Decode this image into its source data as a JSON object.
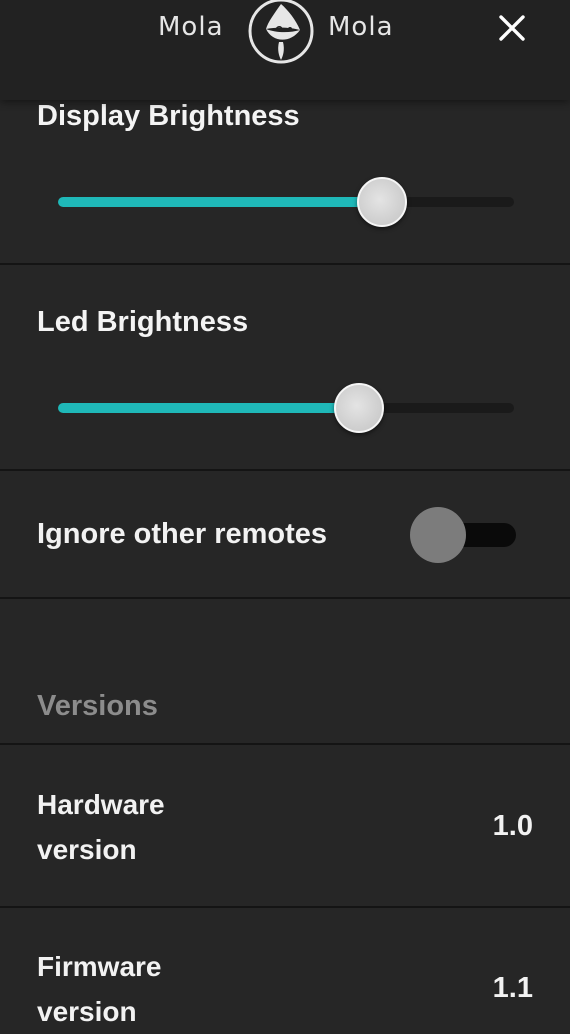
{
  "header": {
    "logo_left": "Mola",
    "logo_right": "Mola",
    "close_icon": "close-icon"
  },
  "settings": {
    "display_brightness": {
      "label": "Display Brightness",
      "value_percent": 71
    },
    "led_brightness": {
      "label": "Led Brightness",
      "value_percent": 66
    },
    "ignore_remotes": {
      "label": "Ignore other remotes",
      "enabled": false
    }
  },
  "versions": {
    "heading": "Versions",
    "hardware": {
      "label_line1": "Hardware",
      "label_line2": "version",
      "value": "1.0"
    },
    "firmware": {
      "label_line1": "Firmware",
      "label_line2": "version",
      "value": "1.1"
    }
  },
  "colors": {
    "accent": "#1fb8b8",
    "background": "#262626",
    "header": "#222222",
    "muted_text": "#8c8c8c"
  }
}
